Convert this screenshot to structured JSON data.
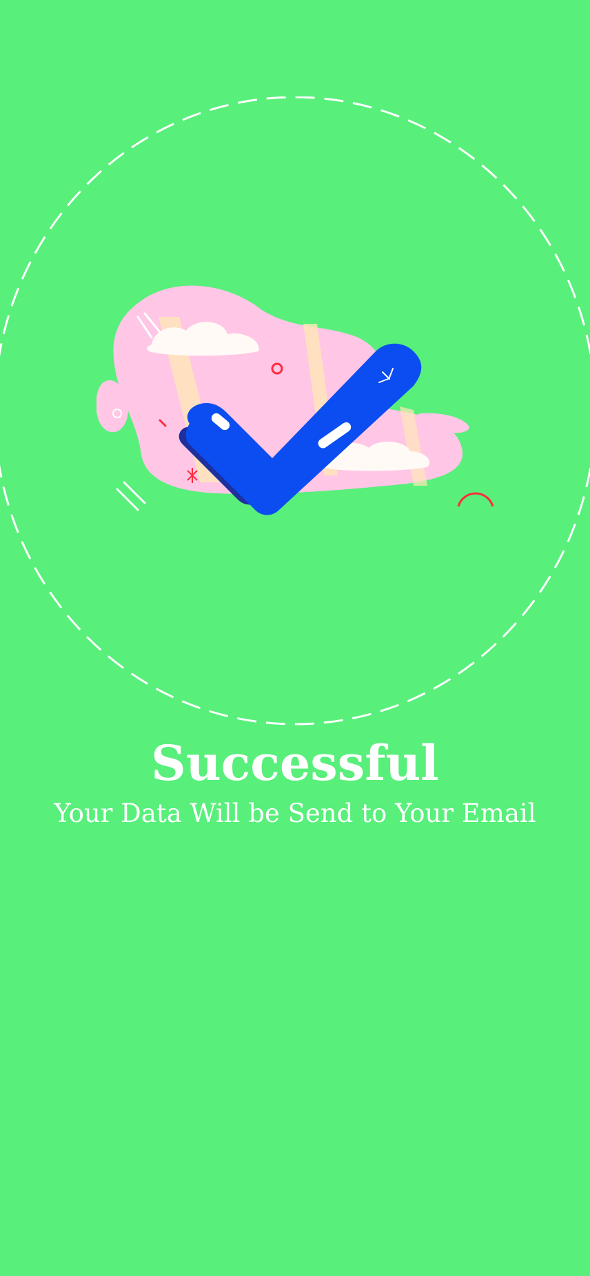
{
  "screen": {
    "title": "Successful",
    "message": "Your Data Will be Send to Your Email"
  },
  "colors": {
    "background": "#58ef7b",
    "text": "#ffffff",
    "checkmark": "#0b4df0",
    "checkmark_shadow": "#1e2f9e",
    "blob": "#ffc6e6",
    "accent": "#ff2b3d"
  },
  "icons": {
    "illustration": "success-checkmark-icon"
  }
}
